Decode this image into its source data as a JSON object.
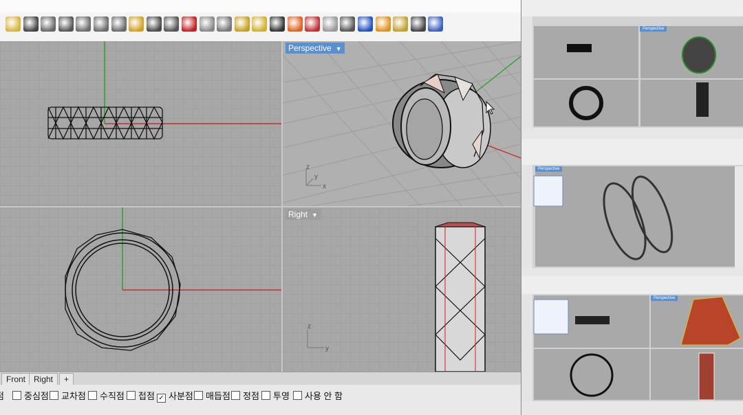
{
  "toolbar": {
    "icons": [
      "clipboard-icon",
      "undo-icon",
      "pan-hand-icon",
      "move-icon",
      "zoom-in-icon",
      "zoom-window-icon",
      "zoom-extents-icon",
      "zoom-selected-icon",
      "rotate-view-icon",
      "four-viewports-icon",
      "car-icon",
      "pan-icon",
      "target-icon",
      "lights-icon",
      "bulb-icon",
      "lock-icon",
      "shade-icon",
      "color-wheel-icon",
      "sphere-ghost-icon",
      "sphere-shade-icon",
      "sphere-render-icon",
      "pen-icon",
      "gear-icon",
      "snap-icon",
      "help-icon"
    ]
  },
  "viewports": {
    "top": {
      "label": ""
    },
    "perspective": {
      "label": "Perspective"
    },
    "front": {
      "label": ""
    },
    "right": {
      "label": "Right"
    }
  },
  "axes": {
    "z": "z",
    "y": "y",
    "x": "x"
  },
  "tabs": [
    "Front",
    "Right",
    "+"
  ],
  "osnap": [
    {
      "label": "점",
      "checked": false
    },
    {
      "label": "중심점",
      "checked": false
    },
    {
      "label": "교차점",
      "checked": false
    },
    {
      "label": "수직점",
      "checked": false
    },
    {
      "label": "접점",
      "checked": false
    },
    {
      "label": "사분점",
      "checked": true
    },
    {
      "label": "매듭점",
      "checked": false
    },
    {
      "label": "정점",
      "checked": false
    },
    {
      "label": "투영",
      "checked": false
    },
    {
      "label": "사용 안 함",
      "checked": false
    }
  ],
  "thumbnails": {
    "thumb1_label": "Perspective",
    "thumb2_label": "Perspective",
    "thumb3_label": "Perspective"
  }
}
